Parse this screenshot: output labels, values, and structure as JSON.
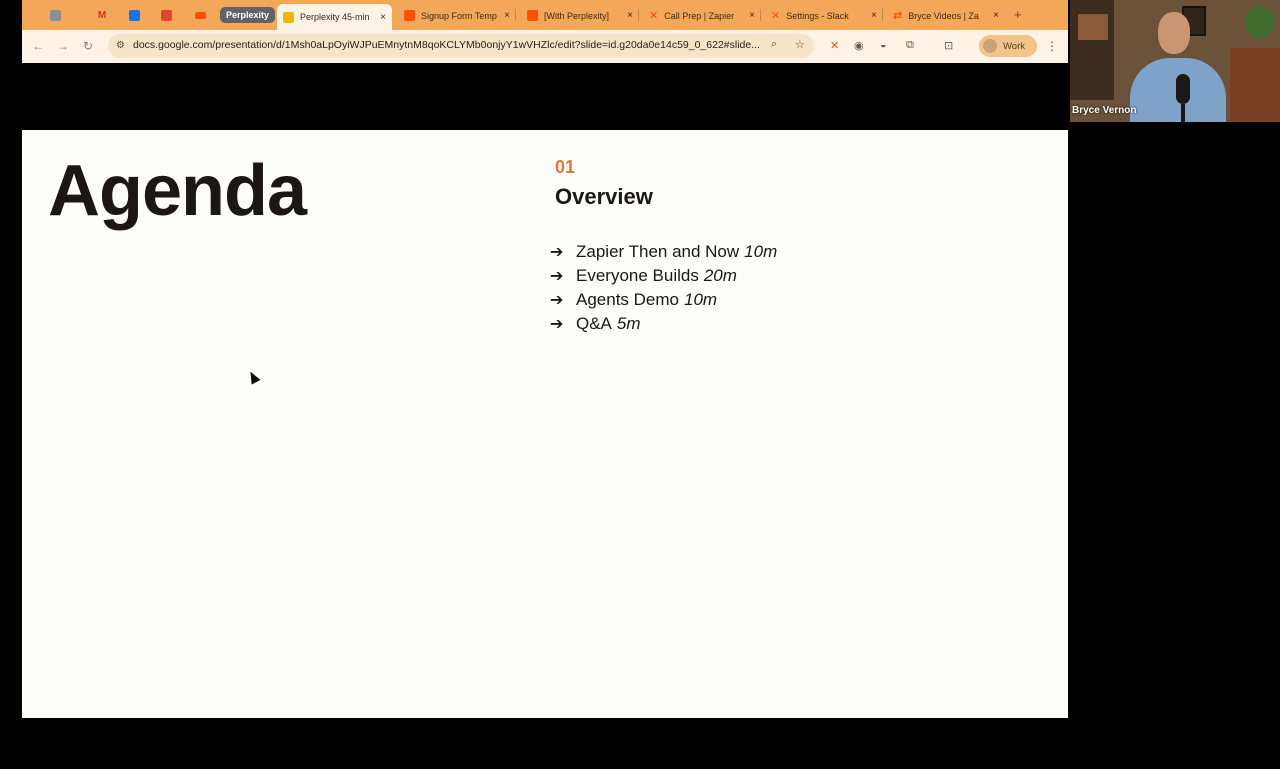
{
  "browser": {
    "tabs": [
      {
        "label": "",
        "icon": "dashboard-icon",
        "color": "#8a8f96"
      },
      {
        "label": "",
        "icon": "gmail-icon",
        "color": "#d93025"
      },
      {
        "label": "",
        "icon": "calendar-icon",
        "color": "#1a73e8"
      },
      {
        "label": "",
        "icon": "todoist-icon",
        "color": "#e44332"
      },
      {
        "label": "",
        "icon": "zapier-icon",
        "color": "#ff4f00"
      },
      {
        "label": "Perplexity 45-min",
        "icon": "slides-icon",
        "color": "#f4b400",
        "close": "×"
      },
      {
        "label": "Signup Form Temp",
        "icon": "zapier-interfaces-icon",
        "color": "#ff4f00",
        "close": "×"
      },
      {
        "label": "[With Perplexity]",
        "icon": "zapier-interfaces-icon",
        "color": "#ff4f00",
        "close": "×"
      },
      {
        "label": "Call Prep | Zapier",
        "icon": "zapier-x-icon",
        "color": "#ff4f00",
        "close": "×"
      },
      {
        "label": "Settings - Slack",
        "icon": "zapier-x-icon",
        "color": "#ff4f00",
        "close": "×"
      },
      {
        "label": "Bryce Videos | Za",
        "icon": "zapier-flow-icon",
        "color": "#ff4f00",
        "close": "×"
      }
    ],
    "group_label": "Perplexity",
    "new_tab": "+",
    "url": "docs.google.com/presentation/d/1Msh0aLpOyiWJPuEMnytnM8qoKCLYMb0onjyY1wVHZlc/edit?slide=id.g20da0e14c59_0_622#slide...",
    "profile_label": "Work"
  },
  "slide": {
    "title": "Agenda",
    "section_number": "01",
    "section_title": "Overview",
    "items": [
      {
        "label": "Zapier Then and Now",
        "duration": "10m"
      },
      {
        "label": "Everyone Builds",
        "duration": "20m"
      },
      {
        "label": "Agents Demo",
        "duration": "10m"
      },
      {
        "label": "Q&A",
        "duration": "5m"
      }
    ],
    "accent_color": "#e8743b"
  },
  "webcam": {
    "participant_name": "Bryce Vernon"
  }
}
